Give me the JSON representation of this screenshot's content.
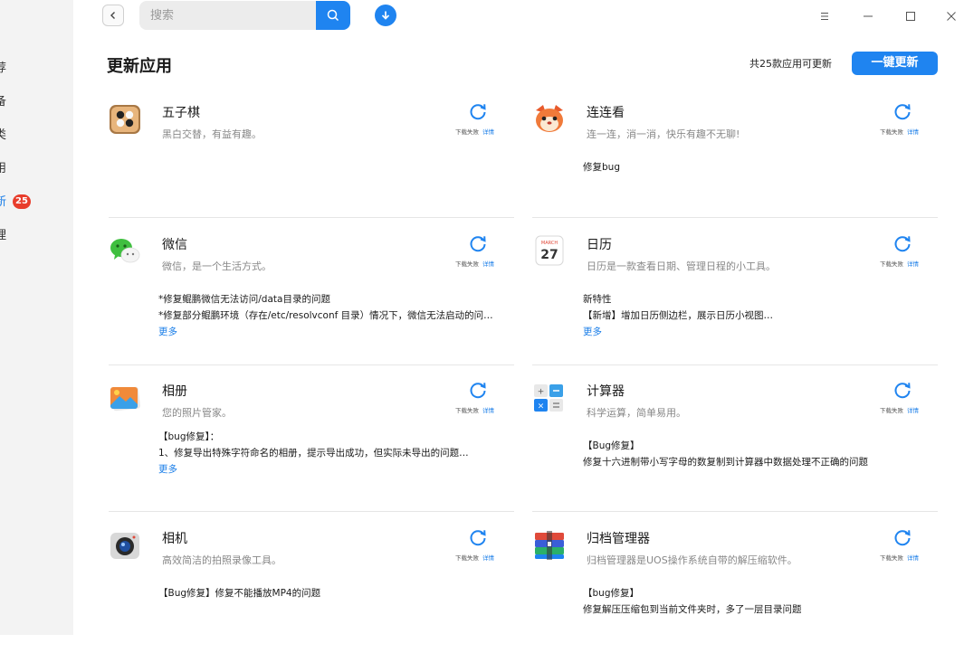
{
  "sidebar": {
    "items": [
      {
        "label": "荐"
      },
      {
        "label": "备"
      },
      {
        "label": "类"
      },
      {
        "label": "用"
      },
      {
        "label": "新",
        "badge": "25"
      },
      {
        "label": "理"
      }
    ]
  },
  "toolbar": {
    "search_placeholder": "搜索"
  },
  "page": {
    "title": "更新应用",
    "count_text": "共25款应用可更新",
    "update_all_label": "一键更新"
  },
  "apps": [
    {
      "name": "五子棋",
      "desc": "黑白交替，有益有趣。",
      "status": "下载失败",
      "detail": "详情",
      "notes": [],
      "more": ""
    },
    {
      "name": "连连看",
      "desc": "连一连，消一消，快乐有趣不无聊!",
      "status": "下载失败",
      "detail": "详情",
      "notes": [
        "修复bug"
      ],
      "more": ""
    },
    {
      "name": "微信",
      "desc": "微信，是一个生活方式。",
      "status": "下载失败",
      "detail": "详情",
      "notes": [
        "*修复鲲鹏微信无法访问/data目录的问题",
        "*修复部分鲲鹏环境（存在/etc/resolvconf 目录）情况下，微信无法启动的问…"
      ],
      "more": "更多"
    },
    {
      "name": "日历",
      "desc": "日历是一款查看日期、管理日程的小工具。",
      "status": "下载失败",
      "detail": "详情",
      "icon_text_month": "MARCH",
      "icon_text_day": "27",
      "notes": [
        "新特性",
        "【新增】增加日历侧边栏，展示日历小视图…"
      ],
      "more": "更多"
    },
    {
      "name": "相册",
      "desc": "您的照片管家。",
      "status": "下载失败",
      "detail": "详情",
      "notes": [
        "【bug修复】：",
        "1、修复导出特殊字符命名的相册，提示导出成功，但实际未导出的问题…"
      ],
      "more": "更多"
    },
    {
      "name": "计算器",
      "desc": "科学运算，简单易用。",
      "status": "下载失败",
      "detail": "详情",
      "notes": [
        "【Bug修复】",
        "修复十六进制带小写字母的数复制到计算器中数据处理不正确的问题"
      ],
      "more": ""
    },
    {
      "name": "相机",
      "desc": "高效简洁的拍照录像工具。",
      "status": "下载失败",
      "detail": "详情",
      "notes": [
        "【Bug修复】修复不能播放MP4的问题"
      ],
      "more": ""
    },
    {
      "name": "归档管理器",
      "desc": "归档管理器是UOS操作系统自带的解压缩软件。",
      "status": "下载失败",
      "detail": "详情",
      "notes": [
        "【bug修复】",
        "修复解压压缩包到当前文件夹时，多了一层目录问题"
      ],
      "more": ""
    }
  ],
  "colors": {
    "accent": "#1f84f0",
    "badge": "#e83d2c",
    "sidebar_bg": "#f3f3f3"
  }
}
